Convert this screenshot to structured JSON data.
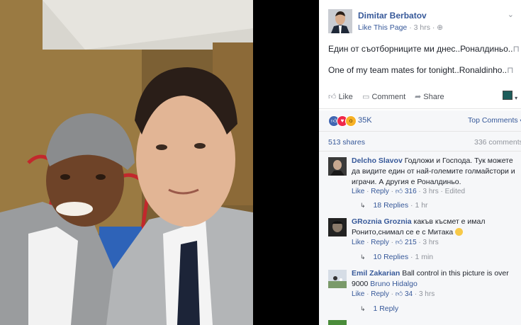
{
  "post": {
    "author": "Dimitar Berbatov",
    "like_page": "Like This Page",
    "time": "3 hrs",
    "text_bg": "Един от съотборниците ми днес..Роналдиньо..",
    "text_en": "One of my team mates for tonight..Ronaldinho..",
    "text_glyph": "⊓"
  },
  "actions": {
    "like": "Like",
    "comment": "Comment",
    "share": "Share"
  },
  "stats": {
    "reactions": "35K",
    "top_comments": "Top Comments",
    "shares": "513 shares",
    "comments": "336 comments"
  },
  "comments": [
    {
      "author": "Delcho Slavov",
      "text": "Годложи и Господа. Тук можете да видите един от най-големите голмайстори и играчи. А другия е Роналдиньо.",
      "like": "Like",
      "reply": "Reply",
      "likes": "316",
      "time": "3 hrs",
      "edited": "Edited",
      "replies": "18 Replies",
      "replies_time": "1 hr"
    },
    {
      "author": "GRoznia Groznia",
      "text": "какъв късмет е имал Ронито,снимал се е с Митака",
      "like": "Like",
      "reply": "Reply",
      "likes": "215",
      "time": "3 hrs",
      "replies": "10 Replies",
      "replies_time": "1 min"
    },
    {
      "author": "Emil Zakarian",
      "text": "Ball control in this picture is over 9000",
      "mention": "Bruno Hidalgo",
      "like": "Like",
      "reply": "Reply",
      "likes": "34",
      "time": "3 hrs",
      "replies": "1 Reply"
    }
  ],
  "colors": {
    "link": "#365899",
    "muted": "#90949c",
    "like_blue": "#4267b2",
    "love_red": "#f0284a",
    "wow_yellow": "#f7b125",
    "panel_grey": "#f6f7f9"
  },
  "icons": [
    "thumb-up-icon",
    "comment-icon",
    "share-arrow-icon",
    "globe-icon",
    "chevron-down-icon",
    "reply-arrow-icon",
    "smile-emoji-icon"
  ]
}
